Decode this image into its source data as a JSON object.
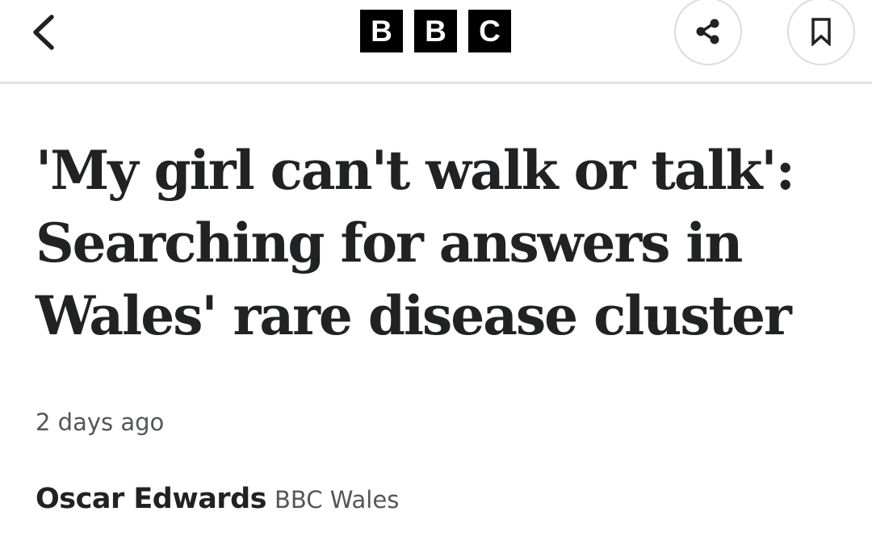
{
  "header": {
    "logo_letters": [
      "B",
      "B",
      "C"
    ],
    "icons": {
      "back": "chevron-left-icon",
      "share": "share-icon",
      "bookmark": "bookmark-icon"
    }
  },
  "article": {
    "headline": "'My girl can't walk or talk': Searching for answers in Wales' rare disease cluster",
    "timestamp": "2 days ago",
    "author": "Oscar Edwards",
    "outlet": "BBC Wales"
  },
  "colors": {
    "text": "#202224",
    "secondary_text": "#545658",
    "logo_background": "#000000",
    "divider": "#e4e4e4"
  }
}
